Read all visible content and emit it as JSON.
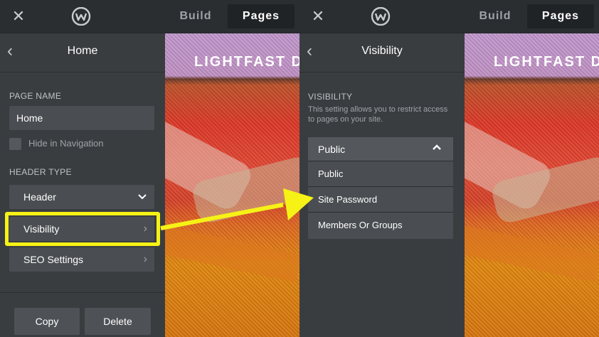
{
  "left": {
    "topbar": {
      "build": "Build",
      "pages": "Pages"
    },
    "panel": {
      "title": "Home",
      "page_name_label": "PAGE NAME",
      "page_name_value": "Home",
      "hide_nav_label": "Hide in Navigation",
      "header_type_label": "HEADER TYPE",
      "header_type_value": "Header",
      "visibility_label": "Visibility",
      "seo_label": "SEO Settings",
      "copy_label": "Copy",
      "delete_label": "Delete"
    },
    "preview_title": "LIGHTFAST D"
  },
  "right": {
    "topbar": {
      "build": "Build",
      "pages": "Pages"
    },
    "panel": {
      "title": "Visibility",
      "section_label": "VISIBILITY",
      "description": "This setting allows you to restrict access to pages on your site.",
      "selected": "Public",
      "options": [
        "Public",
        "Site Password",
        "Members Or Groups"
      ]
    },
    "preview_title": "LIGHTFAST D"
  },
  "colors": {
    "highlight": "#f6f216",
    "panel_bg": "#3a3d40",
    "topbar_bg": "#2b2e31"
  },
  "icons": [
    "close-icon",
    "weebly-logo",
    "back-arrow-icon",
    "chevron-down-icon",
    "chevron-right-icon",
    "chevron-up-icon"
  ]
}
